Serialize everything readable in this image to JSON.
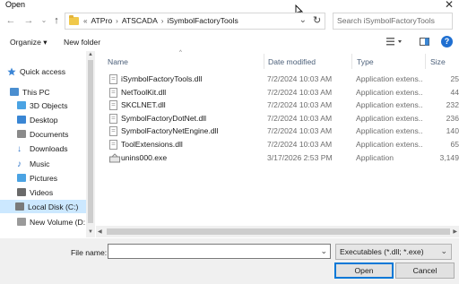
{
  "window": {
    "title": "Open"
  },
  "address": {
    "crumbs": [
      "ATPro",
      "ATSCADA",
      "iSymbolFactoryTools"
    ],
    "lead": "«"
  },
  "search": {
    "placeholder": "Search iSymbolFactoryTools"
  },
  "toolbar": {
    "organize": "Organize ▾",
    "new_folder": "New folder"
  },
  "sidebar": {
    "items": [
      {
        "label": "Quick access",
        "icon": "star-icon",
        "color": "#3c86d6"
      },
      {
        "label": "This PC",
        "icon": "computer-icon",
        "color": "#4a8ed0"
      },
      {
        "label": "3D Objects",
        "icon": "cube-icon",
        "color": "#4ba3e3"
      },
      {
        "label": "Desktop",
        "icon": "desktop-icon",
        "color": "#3a86d4"
      },
      {
        "label": "Documents",
        "icon": "documents-icon",
        "color": "#8a8a8a"
      },
      {
        "label": "Downloads",
        "icon": "download-arrow-icon",
        "color": "#2f76c9"
      },
      {
        "label": "Music",
        "icon": "music-note-icon",
        "color": "#2f76c9"
      },
      {
        "label": "Pictures",
        "icon": "pictures-icon",
        "color": "#4ba3e3"
      },
      {
        "label": "Videos",
        "icon": "videos-icon",
        "color": "#6a6a6a"
      },
      {
        "label": "Local Disk (C:)",
        "icon": "drive-icon",
        "color": "#7a7a7a"
      },
      {
        "label": "New Volume (D:",
        "icon": "drive-icon",
        "color": "#9a9a9a"
      }
    ]
  },
  "columns": {
    "name": "Name",
    "date": "Date modified",
    "type": "Type",
    "size": "Size"
  },
  "files": [
    {
      "name": "iSymbolFactoryTools.dll",
      "date": "7/2/2024 10:03 AM",
      "type": "Application extens...",
      "size": "25"
    },
    {
      "name": "NetToolKit.dll",
      "date": "7/2/2024 10:03 AM",
      "type": "Application extens...",
      "size": "44"
    },
    {
      "name": "SKCLNET.dll",
      "date": "7/2/2024 10:03 AM",
      "type": "Application extens...",
      "size": "232"
    },
    {
      "name": "SymbolFactoryDotNet.dll",
      "date": "7/2/2024 10:03 AM",
      "type": "Application extens...",
      "size": "236"
    },
    {
      "name": "SymbolFactoryNetEngine.dll",
      "date": "7/2/2024 10:03 AM",
      "type": "Application extens...",
      "size": "140"
    },
    {
      "name": "ToolExtensions.dll",
      "date": "7/2/2024 10:03 AM",
      "type": "Application extens...",
      "size": "65"
    },
    {
      "name": "unins000.exe",
      "date": "3/17/2026 2:53 PM",
      "type": "Application",
      "size": "3,149"
    }
  ],
  "bottom": {
    "file_name_label": "File name:",
    "file_name_value": "",
    "filter": "Executables (*.dll; *.exe)",
    "open": "Open",
    "cancel": "Cancel"
  },
  "colors": {
    "accent": "#0078d7",
    "selection": "#cce8ff",
    "help": "#1f6fd1"
  }
}
